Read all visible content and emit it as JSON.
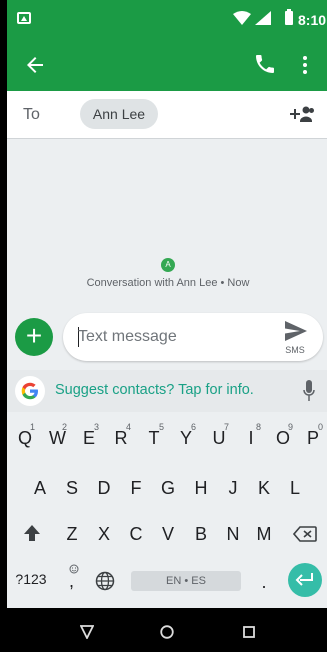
{
  "status_bar": {
    "time": "8:10",
    "wifi_icon": "wifi-icon",
    "signal_icon": "signal-icon",
    "battery_icon": "battery-icon"
  },
  "toolbar": {
    "back_icon": "arrow-back-icon",
    "call_icon": "phone-icon",
    "more_icon": "more-vert-icon",
    "color": "#1b9b45"
  },
  "recipient_bar": {
    "to_label": "To",
    "recipient": "Ann Lee",
    "add_icon": "group-add-icon"
  },
  "conversation": {
    "avatar_letter": "A",
    "info": "Conversation with Ann Lee • Now"
  },
  "compose": {
    "attach_label": "+",
    "placeholder": "Text message",
    "value": "",
    "send_label": "SMS"
  },
  "suggestion": {
    "text": "Suggest contacts? Tap for info.",
    "color": "#1aa186"
  },
  "keyboard": {
    "row1": [
      {
        "k": "Q",
        "h": "1"
      },
      {
        "k": "W",
        "h": "2"
      },
      {
        "k": "E",
        "h": "3"
      },
      {
        "k": "R",
        "h": "4"
      },
      {
        "k": "T",
        "h": "5"
      },
      {
        "k": "Y",
        "h": "6"
      },
      {
        "k": "U",
        "h": "7"
      },
      {
        "k": "I",
        "h": "8"
      },
      {
        "k": "O",
        "h": "9"
      },
      {
        "k": "P",
        "h": "0"
      }
    ],
    "row2": [
      "A",
      "S",
      "D",
      "F",
      "G",
      "H",
      "J",
      "K",
      "L"
    ],
    "row3": [
      "Z",
      "X",
      "C",
      "V",
      "B",
      "N",
      "M"
    ],
    "symbols_label": "?123",
    "comma_label": ",",
    "period_label": ".",
    "language_label": "EN • ES",
    "enter_color": "#35bda8"
  }
}
